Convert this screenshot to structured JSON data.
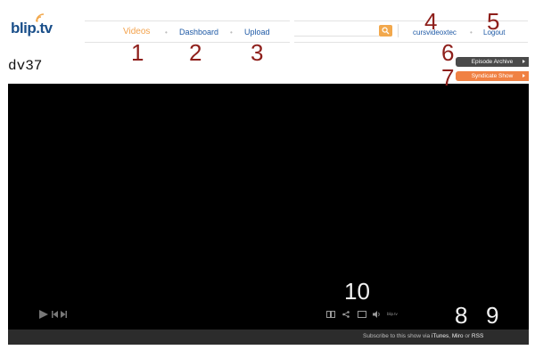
{
  "header": {
    "logo_text": "blip.tv",
    "nav": {
      "videos": "Videos",
      "dashboard": "Dashboard",
      "upload": "Upload"
    },
    "nav_separator": "•",
    "search": {
      "value": "",
      "placeholder": ""
    },
    "user_link": "cursvideoxtec",
    "logout": "Logout"
  },
  "page": {
    "title": "dv37",
    "episode_archive": "Episode Archive",
    "syndicate_show": "Syndicate Show"
  },
  "player": {
    "brand": "blip.tv",
    "subscribe_text": "Subscribe to this show via",
    "subscribe_itunes": "iTunes",
    "subscribe_miro": "Miro",
    "subscribe_or": "or",
    "subscribe_rss": "RSS"
  },
  "annotations": [
    "1",
    "2",
    "3",
    "4",
    "5",
    "6",
    "7",
    "8",
    "9",
    "10"
  ],
  "colors": {
    "nav_active": "#f3a24c",
    "link": "#1f5aa6",
    "annotation": "#8e1f1b",
    "orange_pill": "#f08143",
    "dark_pill": "#4a4a4a"
  }
}
